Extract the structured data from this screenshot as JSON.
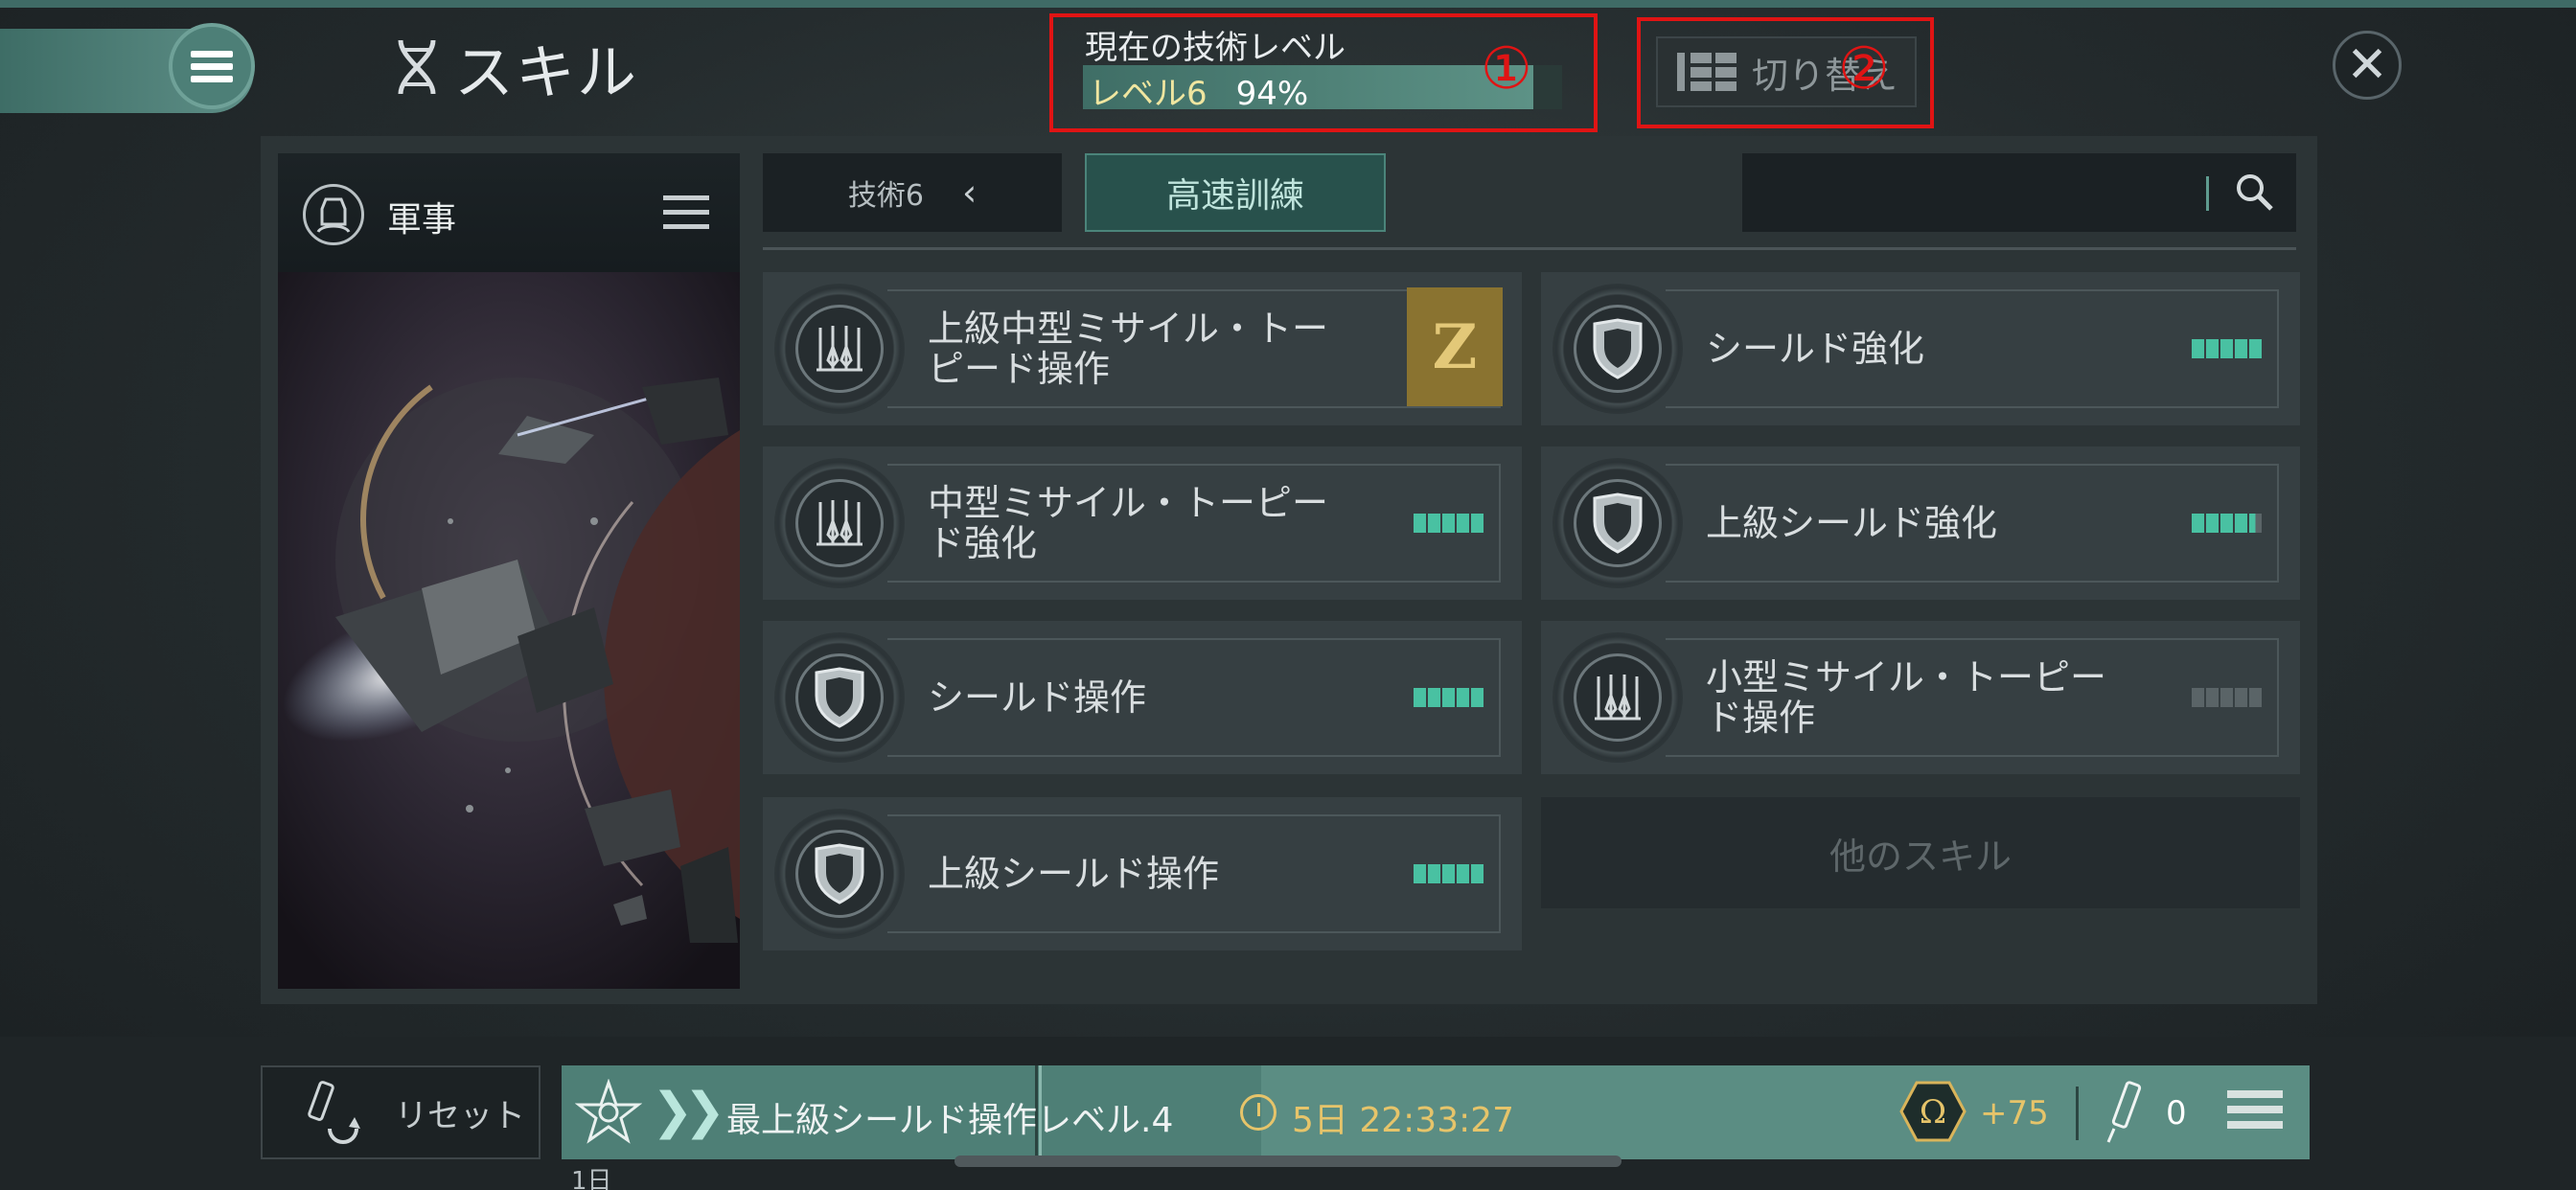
{
  "header": {
    "title": "スキル",
    "tech_level_caption": "現在の技術レベル",
    "tech_level_label": "レベル6",
    "tech_level_percent": "94%",
    "tech_level_progress": 0.94,
    "annotation_1": "①",
    "switch_label": "切り替え",
    "annotation_2": "②",
    "icons": {
      "menu": "hamburger-icon",
      "title": "dna-icon",
      "switch": "grid-list-icon",
      "close": "close-icon"
    }
  },
  "sidebar": {
    "category": "軍事",
    "icons": {
      "avatar": "pilot-icon",
      "menu": "hamburger-icon"
    }
  },
  "filters": {
    "tech": "技術6",
    "tech_chevron": "‹",
    "fast_training": "高速訓練",
    "search_placeholder": ""
  },
  "skills": [
    {
      "name": "上級中型ミサイル・トーピード操作",
      "icon": "missile-rack-icon",
      "level": 0,
      "badge": "Z"
    },
    {
      "name": "シールド強化",
      "icon": "shield-icon",
      "level": 5
    },
    {
      "name": "中型ミサイル・トーピード強化",
      "icon": "missile-rack-icon",
      "level": 5
    },
    {
      "name": "上級シールド強化",
      "icon": "shield-icon",
      "level": 4.5
    },
    {
      "name": "シールド操作",
      "icon": "shield-icon",
      "level": 5
    },
    {
      "name": "小型ミサイル・トーピード操作",
      "icon": "missile-rack-icon",
      "level": 0
    },
    {
      "name": "上級シールド操作",
      "icon": "shield-icon",
      "level": 5
    }
  ],
  "other_skills": "他のスキル",
  "bottom": {
    "reset": "リセット",
    "queue_label": "最上級シールド操作レベル.4",
    "queue_time": "5日 22:33:27",
    "queue_progress": 0.4,
    "omega_bonus": "+75",
    "injector_count": "0",
    "day_label": "1日",
    "colors": {
      "accent": "#5b8d83",
      "gold": "#e6c46a",
      "pip_on": "#49c1a2"
    }
  }
}
